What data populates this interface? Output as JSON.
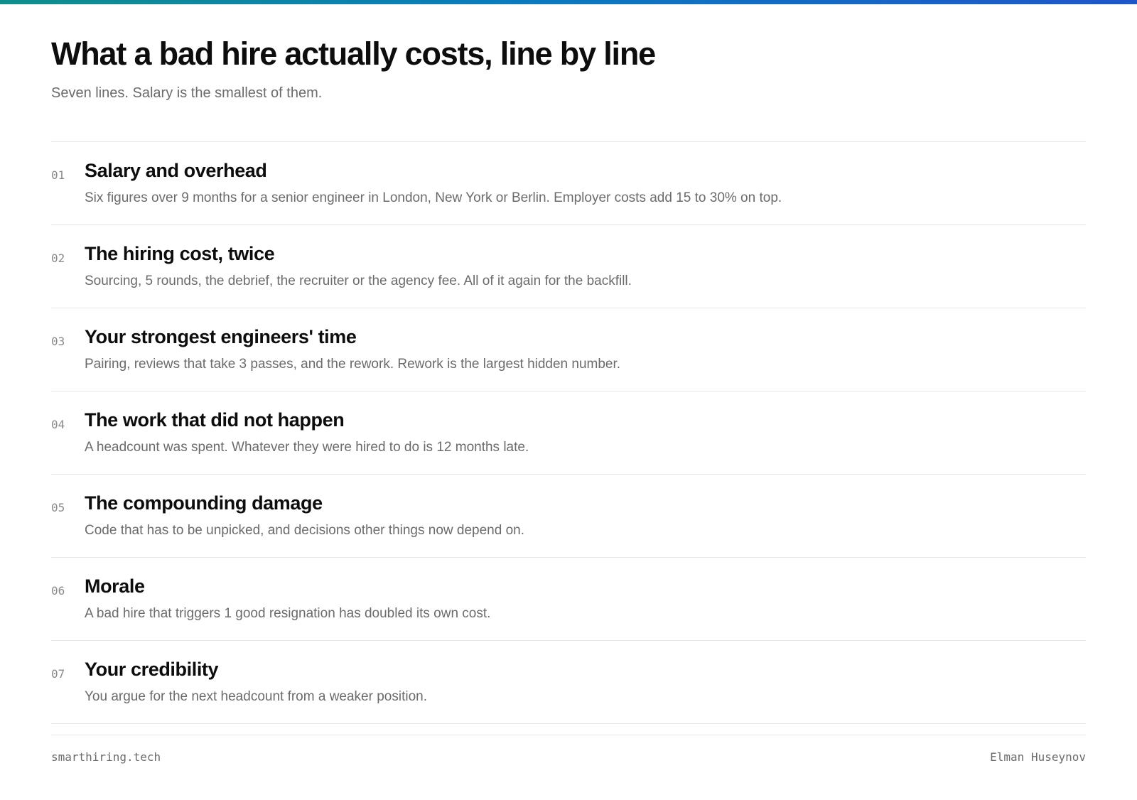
{
  "accent_gradient": [
    "#0f8f8c",
    "#0b7bbd",
    "#1f56c9"
  ],
  "header": {
    "title": "What a bad hire actually costs, line by line",
    "subtitle": "Seven lines. Salary is the smallest of them."
  },
  "items": [
    {
      "num": "01",
      "title": "Salary and overhead",
      "desc": "Six figures over 9 months for a senior engineer in London, New York or Berlin. Employer costs add 15 to 30% on top."
    },
    {
      "num": "02",
      "title": "The hiring cost, twice",
      "desc": "Sourcing, 5 rounds, the debrief, the recruiter or the agency fee. All of it again for the backfill."
    },
    {
      "num": "03",
      "title": "Your strongest engineers' time",
      "desc": "Pairing, reviews that take 3 passes, and the rework. Rework is the largest hidden number."
    },
    {
      "num": "04",
      "title": "The work that did not happen",
      "desc": "A headcount was spent. Whatever they were hired to do is 12 months late."
    },
    {
      "num": "05",
      "title": "The compounding damage",
      "desc": "Code that has to be unpicked, and decisions other things now depend on."
    },
    {
      "num": "06",
      "title": "Morale",
      "desc": "A bad hire that triggers 1 good resignation has doubled its own cost."
    },
    {
      "num": "07",
      "title": "Your credibility",
      "desc": "You argue for the next headcount from a weaker position."
    }
  ],
  "footer": {
    "site": "smarthiring.tech",
    "author": "Elman Huseynov"
  }
}
